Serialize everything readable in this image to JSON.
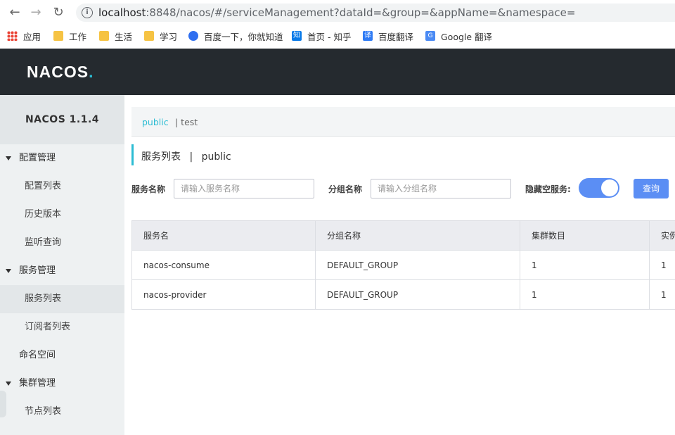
{
  "browser": {
    "back_icon": "arrow-left-icon",
    "forward_icon": "arrow-right-icon",
    "reload_icon": "reload-icon",
    "url_host": "localhost",
    "url_rest": ":8848/nacos/#/serviceManagement?dataId=&group=&appName=&namespace=",
    "bookmarks": [
      {
        "label": "应用",
        "icon": "apps-grid-icon"
      },
      {
        "label": "工作",
        "icon": "folder-icon"
      },
      {
        "label": "生活",
        "icon": "folder-icon"
      },
      {
        "label": "学习",
        "icon": "folder-icon"
      },
      {
        "label": "百度一下，你就知道",
        "icon": "baidu-paw-icon"
      },
      {
        "label": "首页 - 知乎",
        "icon": "zhihu-icon",
        "glyph": "知"
      },
      {
        "label": "百度翻译",
        "icon": "baidu-translate-icon",
        "glyph": "译"
      },
      {
        "label": "Google 翻译",
        "icon": "google-translate-icon",
        "glyph": "G"
      }
    ]
  },
  "header": {
    "logo_text": "NACOS",
    "logo_dot": "."
  },
  "sidebar": {
    "version": "NACOS 1.1.4",
    "items": [
      {
        "label": "配置管理",
        "type": "group"
      },
      {
        "label": "配置列表",
        "type": "sub"
      },
      {
        "label": "历史版本",
        "type": "sub"
      },
      {
        "label": "监听查询",
        "type": "sub"
      },
      {
        "label": "服务管理",
        "type": "group"
      },
      {
        "label": "服务列表",
        "type": "sub",
        "active": true
      },
      {
        "label": "订阅者列表",
        "type": "sub"
      },
      {
        "label": "命名空间",
        "type": "plain"
      },
      {
        "label": "集群管理",
        "type": "group"
      },
      {
        "label": "节点列表",
        "type": "sub"
      }
    ]
  },
  "namespace_bar": {
    "active": "public",
    "other": "| test"
  },
  "page": {
    "title": "服务列表",
    "separator": "|",
    "namespace": "public"
  },
  "filters": {
    "service_name_label": "服务名称",
    "service_name_placeholder": "请输入服务名称",
    "group_name_label": "分组名称",
    "group_name_placeholder": "请输入分组名称",
    "hide_empty_label": "隐藏空服务:",
    "hide_empty_on": true,
    "query_button": "查询"
  },
  "table": {
    "columns": [
      "服务名",
      "分组名称",
      "集群数目",
      "实例"
    ],
    "rows": [
      [
        "nacos-consume",
        "DEFAULT_GROUP",
        "1",
        "1"
      ],
      [
        "nacos-provider",
        "DEFAULT_GROUP",
        "1",
        "1"
      ]
    ]
  },
  "colors": {
    "accent": "#2bbcd3",
    "primary_button": "#5b8ef4",
    "topbar": "#252a2f",
    "sidebar": "#eef1f2"
  }
}
